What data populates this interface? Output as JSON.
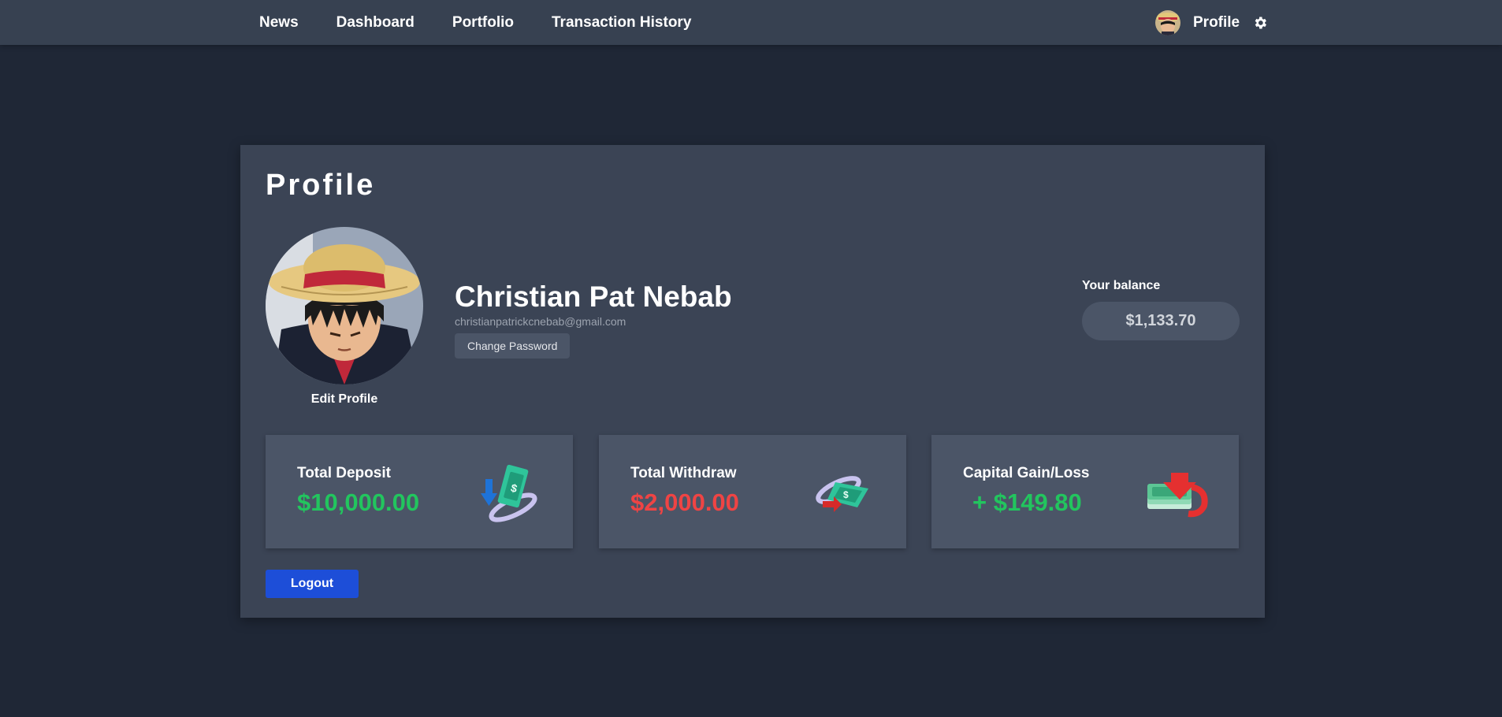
{
  "nav": {
    "links": [
      "News",
      "Dashboard",
      "Portfolio",
      "Transaction History"
    ],
    "profile_label": "Profile",
    "avatar_icon": "anime-avatar-icon",
    "settings_icon": "gear-icon"
  },
  "profile": {
    "title": "Profile",
    "name": "Christian Pat Nebab",
    "email": "christianpatrickcnebab@gmail.com",
    "change_password_label": "Change Password",
    "edit_profile_label": "Edit Profile"
  },
  "balance": {
    "label": "Your balance",
    "value": "$1,133.70"
  },
  "stats": {
    "deposit": {
      "label": "Total Deposit",
      "value": "$10,000.00",
      "color": "#22c55e",
      "icon": "deposit-money-icon"
    },
    "withdraw": {
      "label": "Total Withdraw",
      "value": "$2,000.00",
      "color": "#ef4444",
      "icon": "withdraw-money-icon"
    },
    "gain": {
      "label": "Capital Gain/Loss",
      "value": "+ $149.80",
      "color": "#22c55e",
      "icon": "money-stack-down-icon"
    }
  },
  "logout_label": "Logout",
  "colors": {
    "background": "#1f2736",
    "navbar": "#374151",
    "card": "#3b4455",
    "tile": "#4b5567",
    "accent_blue": "#1d4ed8"
  }
}
